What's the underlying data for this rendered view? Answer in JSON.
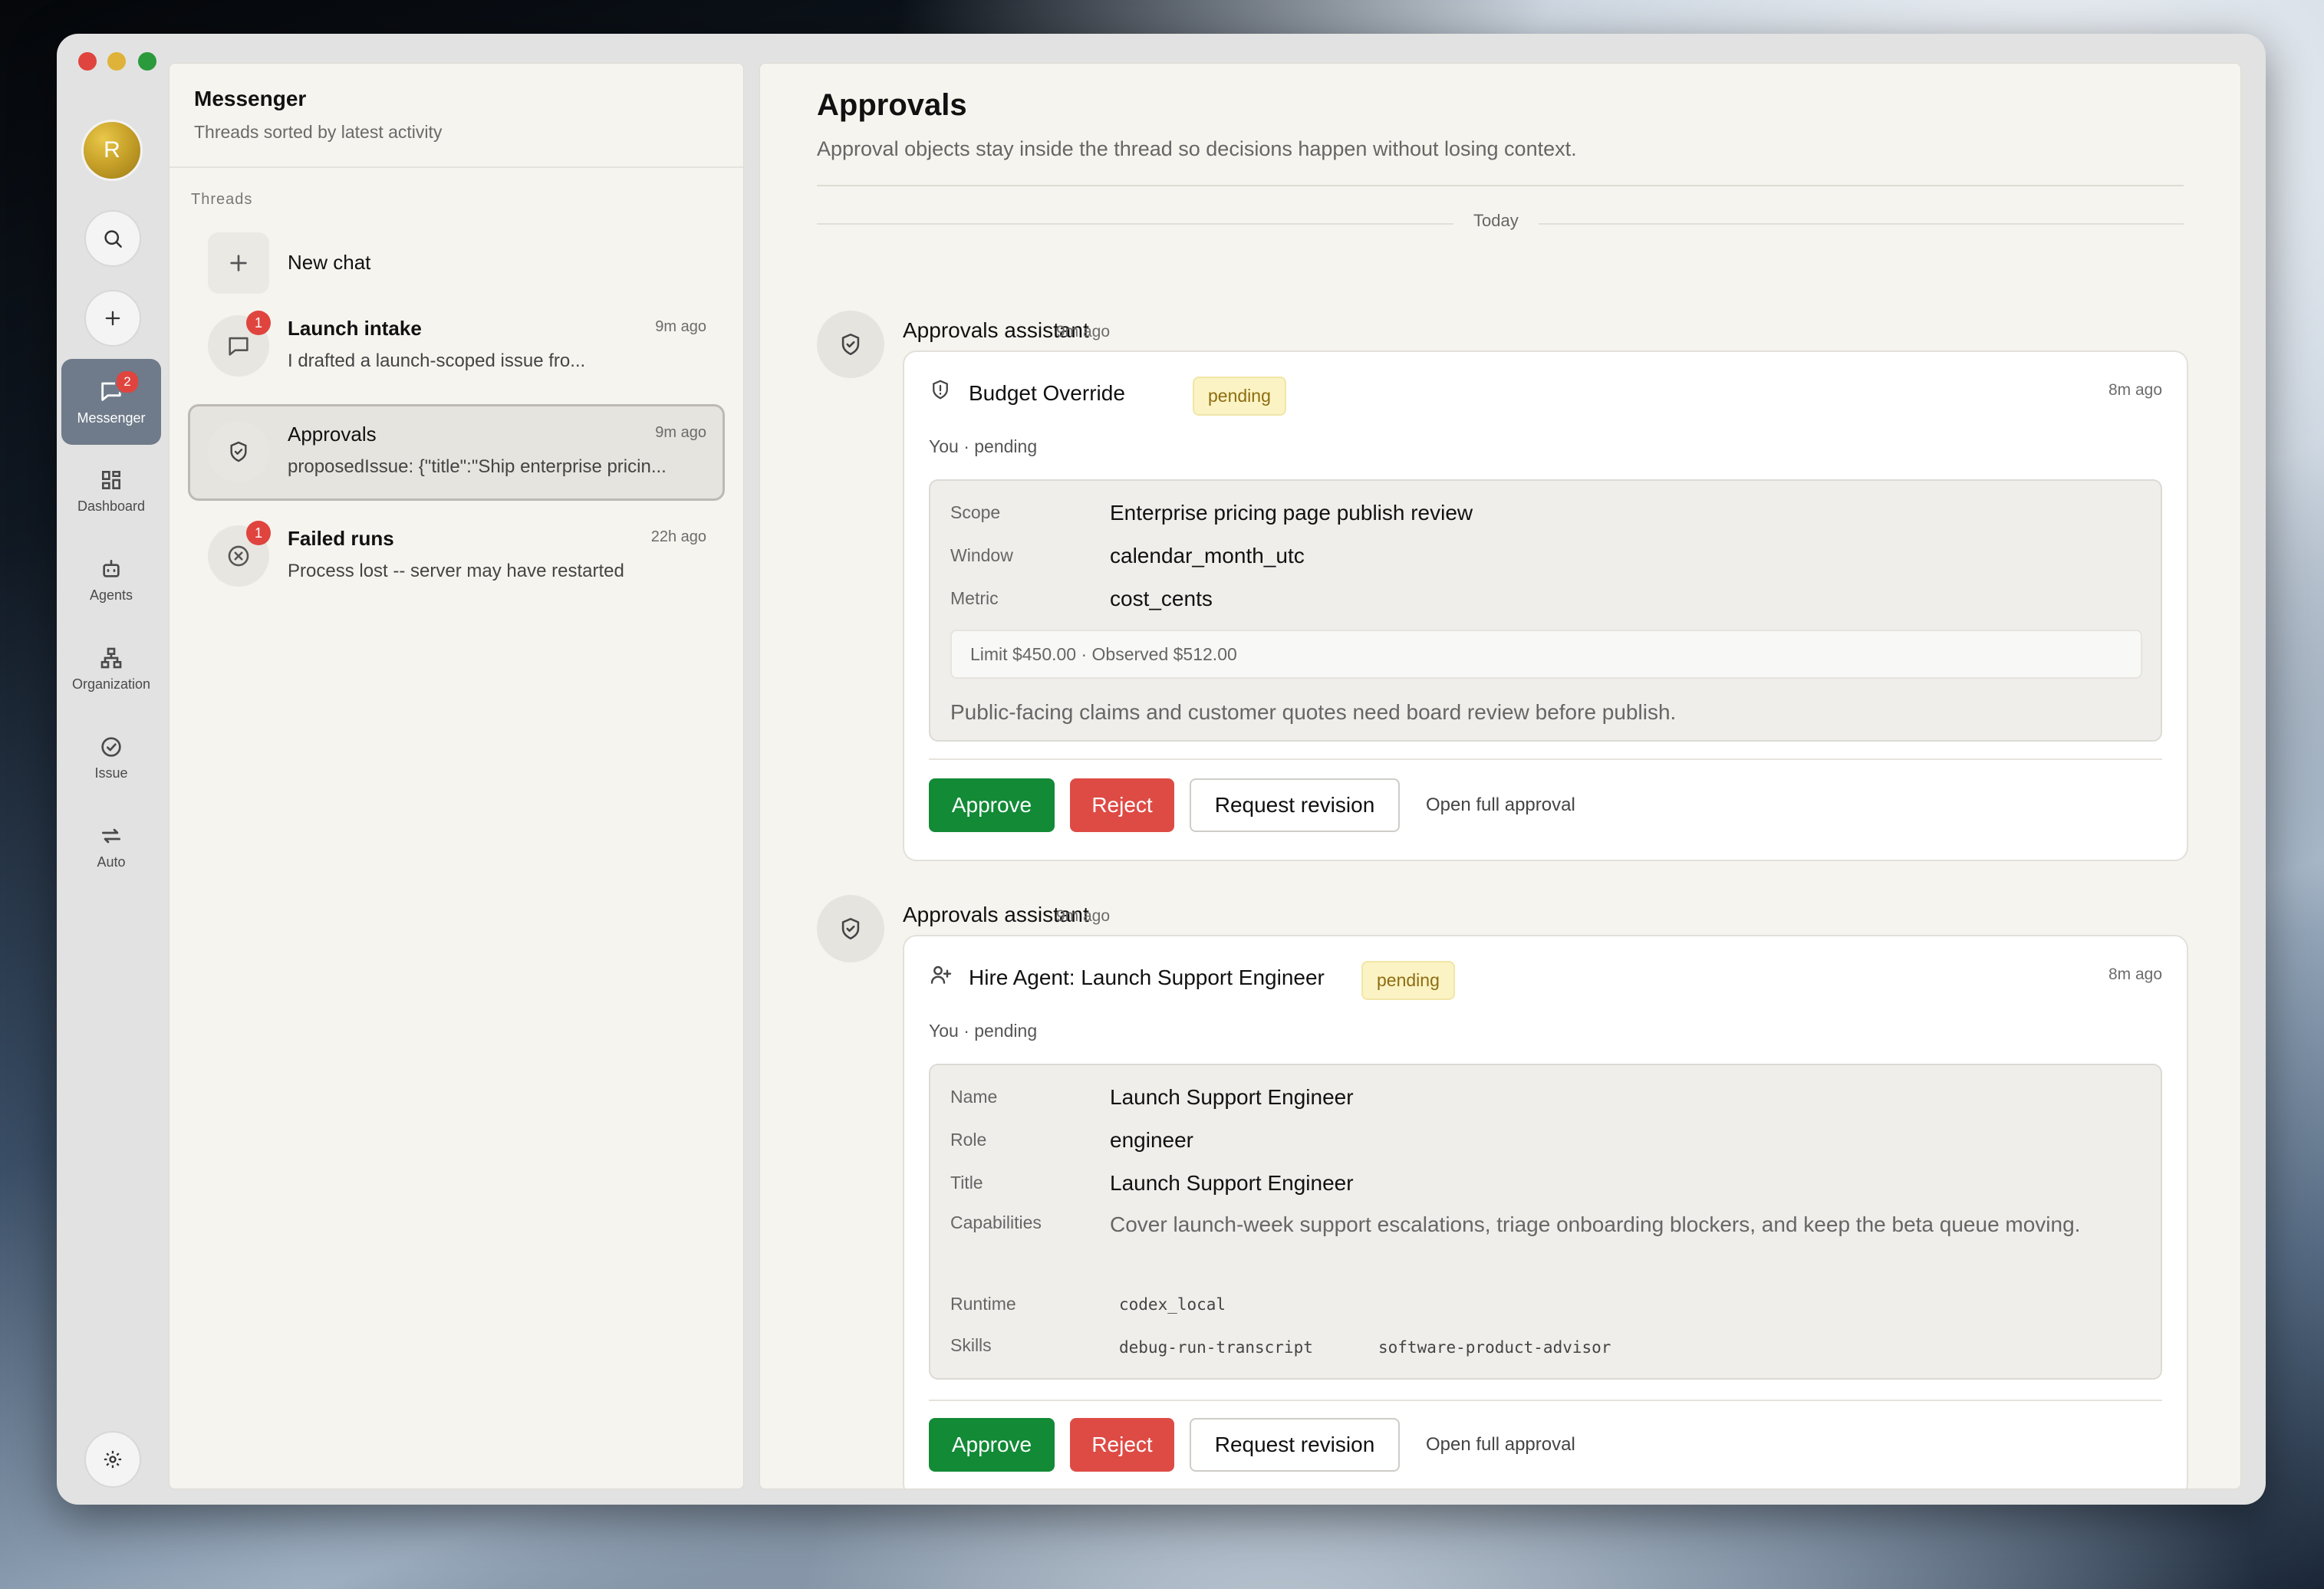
{
  "rail": {
    "avatar_initial": "R",
    "items": [
      {
        "label": "Messenger",
        "badge": "2",
        "icon": "chat-bubble-icon"
      },
      {
        "label": "Dashboard",
        "icon": "dashboard-grid-icon"
      },
      {
        "label": "Agents",
        "icon": "robot-icon"
      },
      {
        "label": "Organization",
        "icon": "org-chart-icon"
      },
      {
        "label": "Issue",
        "icon": "check-circle-icon"
      },
      {
        "label": "Auto",
        "icon": "repeat-arrows-icon"
      }
    ]
  },
  "threads": {
    "title": "Messenger",
    "subtitle": "Threads sorted by latest activity",
    "section_label": "Threads",
    "new_chat_label": "New chat",
    "items": [
      {
        "name": "Launch intake",
        "time": "9m ago",
        "preview": "I drafted a launch-scoped issue fro...",
        "badge": "1",
        "icon": "chat-bubble-icon"
      },
      {
        "name": "Approvals",
        "time": "9m ago",
        "preview": "proposedIssue: {\"title\":\"Ship enterprise pricin...",
        "icon": "shield-check-icon"
      },
      {
        "name": "Failed runs",
        "time": "22h ago",
        "preview": "Process lost -- server may have restarted",
        "badge": "1",
        "icon": "x-circle-icon"
      }
    ]
  },
  "main": {
    "title": "Approvals",
    "subtitle": "Approval objects stay inside the thread so decisions happen without losing context.",
    "day_label": "Today",
    "messages": [
      {
        "author": "Approvals assistant",
        "time": "9m ago",
        "card": {
          "title": "Budget Override",
          "status": "pending",
          "time": "8m ago",
          "who": "You · pending",
          "fields": [
            {
              "key": "Scope",
              "value": "Enterprise pricing page publish review"
            },
            {
              "key": "Window",
              "value": "calendar_month_utc"
            },
            {
              "key": "Metric",
              "value": "cost_cents"
            }
          ],
          "limit": "Limit $450.00 · Observed $512.00",
          "note": "Public-facing claims and customer quotes need board review before publish."
        }
      },
      {
        "author": "Approvals assistant",
        "time": "9m ago",
        "card": {
          "title": "Hire Agent: Launch Support Engineer",
          "status": "pending",
          "time": "8m ago",
          "who": "You · pending",
          "fields": [
            {
              "key": "Name",
              "value": "Launch Support Engineer"
            },
            {
              "key": "Role",
              "value": "engineer"
            },
            {
              "key": "Title",
              "value": "Launch Support Engineer"
            },
            {
              "key": "Capabilities",
              "value": "Cover launch-week support escalations, triage onboarding blockers, and keep the beta queue moving."
            },
            {
              "key": "Runtime",
              "value": "codex_local"
            },
            {
              "key": "Skills",
              "value": [
                "debug-run-transcript",
                "software-product-advisor"
              ]
            }
          ]
        }
      }
    ],
    "actions": {
      "approve": "Approve",
      "reject": "Reject",
      "request_revision": "Request revision",
      "open_full": "Open full approval"
    }
  }
}
